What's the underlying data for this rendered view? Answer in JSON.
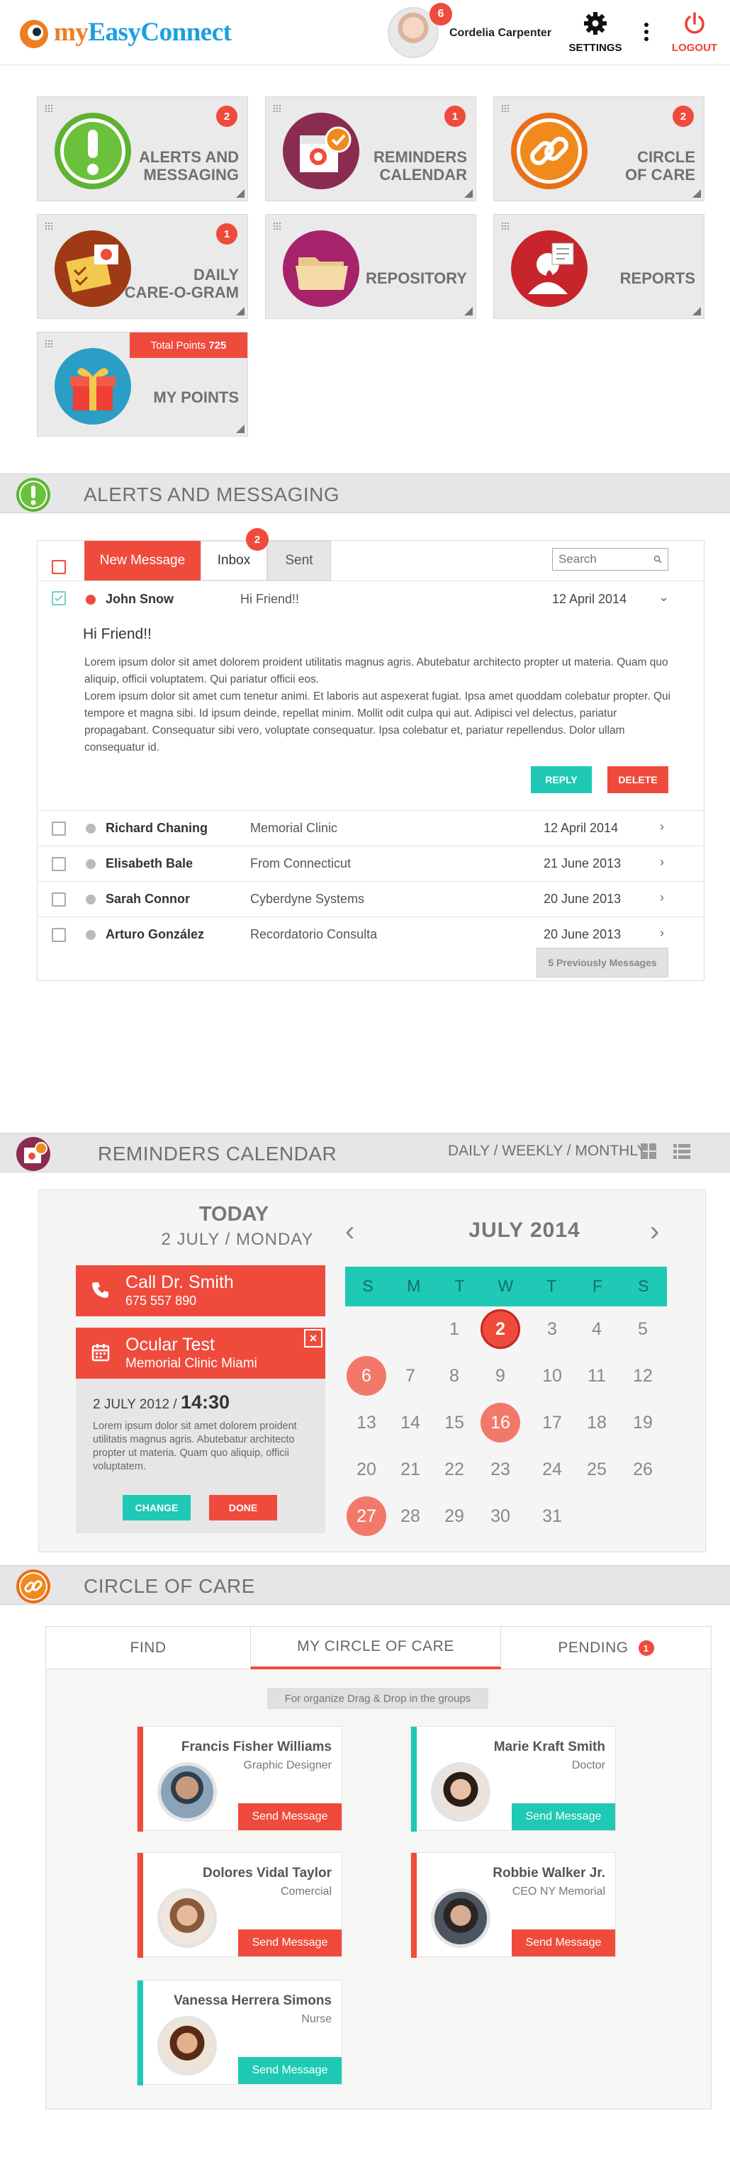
{
  "header": {
    "logo_part1": "my",
    "logo_part2": "EasyConnect",
    "notification_count": "6",
    "user_name": "Cordelia Carpenter",
    "settings_label": "SETTINGS",
    "logout_label": "LOGOUT"
  },
  "tiles": [
    {
      "title_l1": "ALERTS AND",
      "title_l2": "MESSAGING",
      "badge": "2"
    },
    {
      "title_l1": "REMINDERS",
      "title_l2": "CALENDAR",
      "badge": "1"
    },
    {
      "title_l1": "CIRCLE",
      "title_l2": "OF CARE",
      "badge": "2"
    },
    {
      "title_l1": "DAILY",
      "title_l2": "CARE-O-GRAM",
      "badge": "1"
    },
    {
      "title_l1": "REPOSITORY",
      "title_l2": "",
      "badge": ""
    },
    {
      "title_l1": "REPORTS",
      "title_l2": "",
      "badge": ""
    },
    {
      "title_l1": "MY POINTS",
      "title_l2": "",
      "badge": "",
      "points_prefix": "Total Points",
      "points_value": "725"
    }
  ],
  "alerts": {
    "section_title": "ALERTS AND MESSAGING",
    "new_message_label": "New Message",
    "inbox_label": "Inbox",
    "inbox_badge": "2",
    "sent_label": "Sent",
    "search_placeholder": "Search",
    "open_message": {
      "sender": "John Snow",
      "subject": "Hi Friend!!",
      "date": "12 April 2014",
      "body_title": "Hi Friend!!",
      "body_p1": "Lorem ipsum dolor sit amet dolorem proident utilitatis magnus agris. Abutebatur architecto propter ut materia. Quam quo aliquip, officii voluptatem. Qui pariatur officii eos.",
      "body_p2": "Lorem ipsum dolor sit amet cum tenetur animi. Et laboris aut aspexerat fugiat. Ipsa amet quoddam colebatur propter. Qui tempore et magna sibi. Id ipsum deinde, repellat minim. Mollit odit culpa qui aut. Adipisci vel delectus, pariatur propagabant. Consequatur sibi vero, voluptate consequatur. Ipsa colebatur et, pariatur repellendus. Dolor ullam consequatur id.",
      "reply_label": "REPLY",
      "delete_label": "DELETE"
    },
    "messages": [
      {
        "sender": "Richard Chaning",
        "subject": "Memorial Clinic",
        "date": "12 April 2014"
      },
      {
        "sender": "Elisabeth Bale",
        "subject": "From Connecticut",
        "date": "21 June 2013"
      },
      {
        "sender": "Sarah Connor",
        "subject": "Cyberdyne Systems",
        "date": "20 June 2013"
      },
      {
        "sender": "Arturo González",
        "subject": "Recordatorio Consulta",
        "date": "20 June 2013"
      }
    ],
    "previous_label": "5 Previously Messages"
  },
  "reminders": {
    "section_title": "REMINDERS CALENDAR",
    "view_switch": "DAILY / WEEKLY / MONTHLY",
    "today_label": "TODAY",
    "today_date": "2 JULY / MONDAY",
    "call_title": "Call Dr. Smith",
    "call_phone": "675 557 890",
    "event_title": "Ocular Test",
    "event_location": "Memorial Clinic Miami",
    "event_date": "2 JULY 2012 /",
    "event_time": "14:30",
    "event_text": "Lorem ipsum dolor sit amet dolorem proident utilitatis magnus agris. Abutebatur architecto propter ut materia. Quam quo aliquip, officii voluptatem.",
    "change_label": "CHANGE",
    "done_label": "DONE",
    "month_label": "JULY 2014",
    "weekdays": [
      "S",
      "M",
      "T",
      "W",
      "T",
      "F",
      "S"
    ],
    "days": [
      "1",
      "2",
      "3",
      "4",
      "5",
      "6",
      "7",
      "8",
      "9",
      "10",
      "11",
      "12",
      "13",
      "14",
      "15",
      "16",
      "17",
      "18",
      "19",
      "20",
      "21",
      "22",
      "23",
      "24",
      "25",
      "26",
      "27",
      "28",
      "29",
      "30",
      "31"
    ],
    "today_day": "2",
    "event_days": [
      "6",
      "16",
      "27"
    ]
  },
  "circle": {
    "section_title": "CIRCLE OF CARE",
    "tab_find": "FIND",
    "tab_my_circle": "MY CIRCLE OF CARE",
    "tab_pending": "PENDING",
    "pending_count": "1",
    "drag_hint": "For organize Drag & Drop in the groups",
    "send_label": "Send Message",
    "people": [
      {
        "name": "Francis Fisher Williams",
        "role": "Graphic Designer",
        "accent": "#ef4b3d"
      },
      {
        "name": "Marie Kraft Smith",
        "role": "Doctor",
        "accent": "#1fc9b5"
      },
      {
        "name": "Dolores Vidal Taylor",
        "role": "Comercial",
        "accent": "#ef4b3d"
      },
      {
        "name": "Robbie Walker Jr.",
        "role": "CEO NY Memorial",
        "accent": "#ef4b3d"
      },
      {
        "name": "Vanessa Herrera Simons",
        "role": "Nurse",
        "accent": "#1fc9b5"
      }
    ]
  },
  "colors": {
    "accent_red": "#ef4b3d",
    "accent_teal": "#1fc9b5",
    "brand_orange": "#ef7d22",
    "brand_blue": "#1d9ee3"
  }
}
